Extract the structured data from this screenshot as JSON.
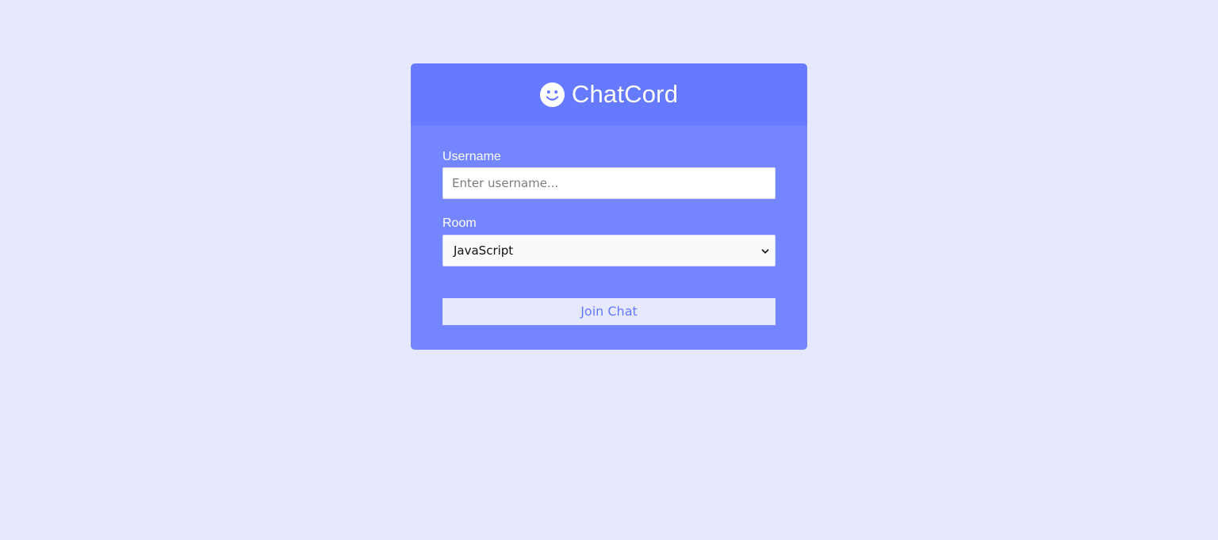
{
  "app": {
    "title": "ChatCord",
    "logo_icon": "smile-icon"
  },
  "colors": {
    "page_background": "#e6e9fd",
    "header_background": "#667aff",
    "panel_background": "#7386ff",
    "button_background": "#e6e9fd",
    "button_text": "#667aff"
  },
  "form": {
    "username": {
      "label": "Username",
      "placeholder": "Enter username...",
      "value": ""
    },
    "room": {
      "label": "Room",
      "selected": "JavaScript",
      "icon": "chevron-down-icon"
    },
    "submit_label": "Join Chat"
  }
}
